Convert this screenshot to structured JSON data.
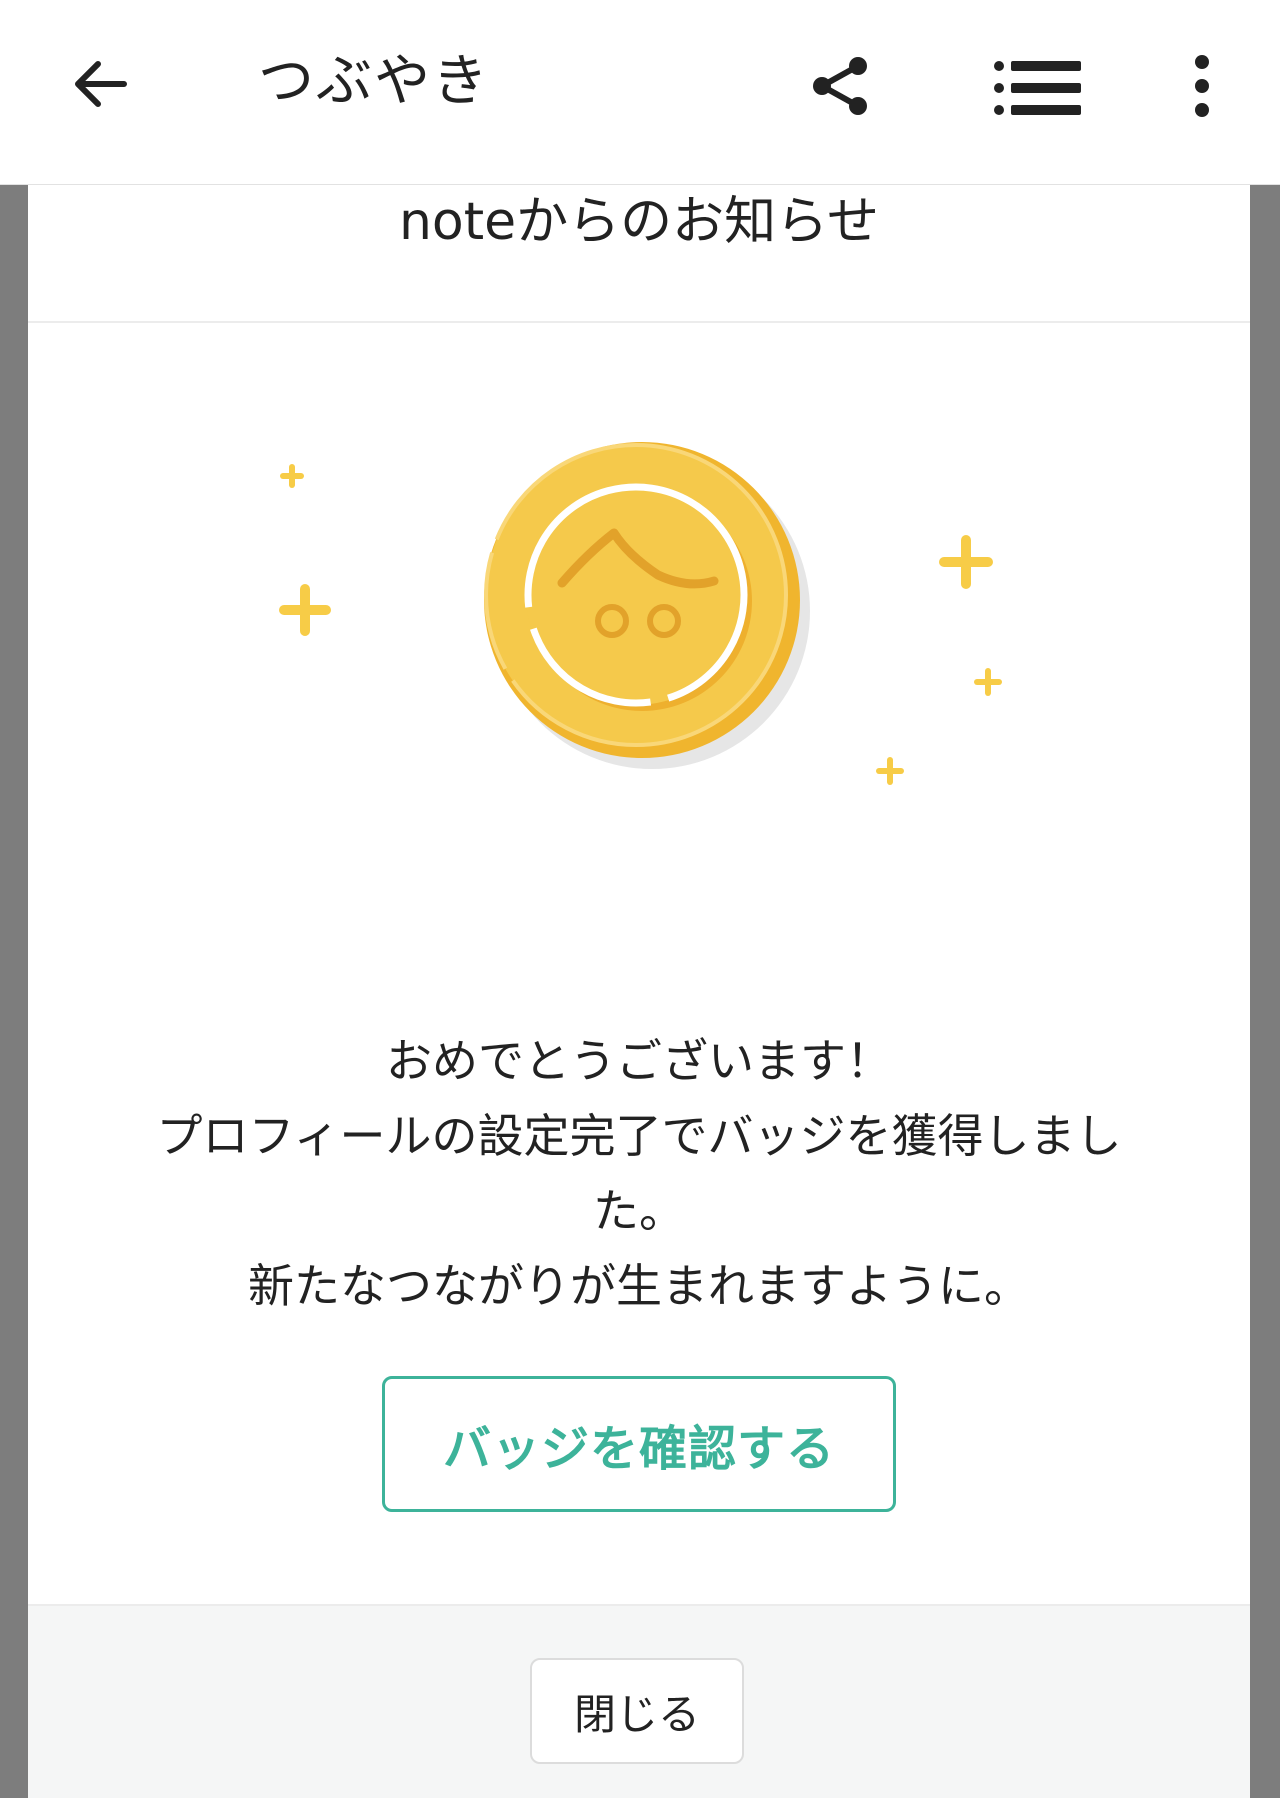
{
  "appbar": {
    "title": "つぶやき",
    "icons": {
      "back": "arrow-back-icon",
      "share": "share-icon",
      "list": "list-icon",
      "more": "more-vert-icon"
    }
  },
  "modal": {
    "heading": "noteからのお知らせ",
    "illustration": "badge-coin-illustration",
    "message_lines": [
      "おめでとうございます！",
      "プロフィールの設定完了でバッジを獲得しまし",
      "た。",
      "新たなつながりが生まれますように。"
    ],
    "primary_button": "バッジを確認する",
    "close_button": "閉じる"
  },
  "colors": {
    "accent": "#3db39a",
    "coin": "#f5c94b",
    "coin_dark": "#e8a92a",
    "sparkle": "#f7cc47",
    "overlay": "#7d7d7d"
  }
}
